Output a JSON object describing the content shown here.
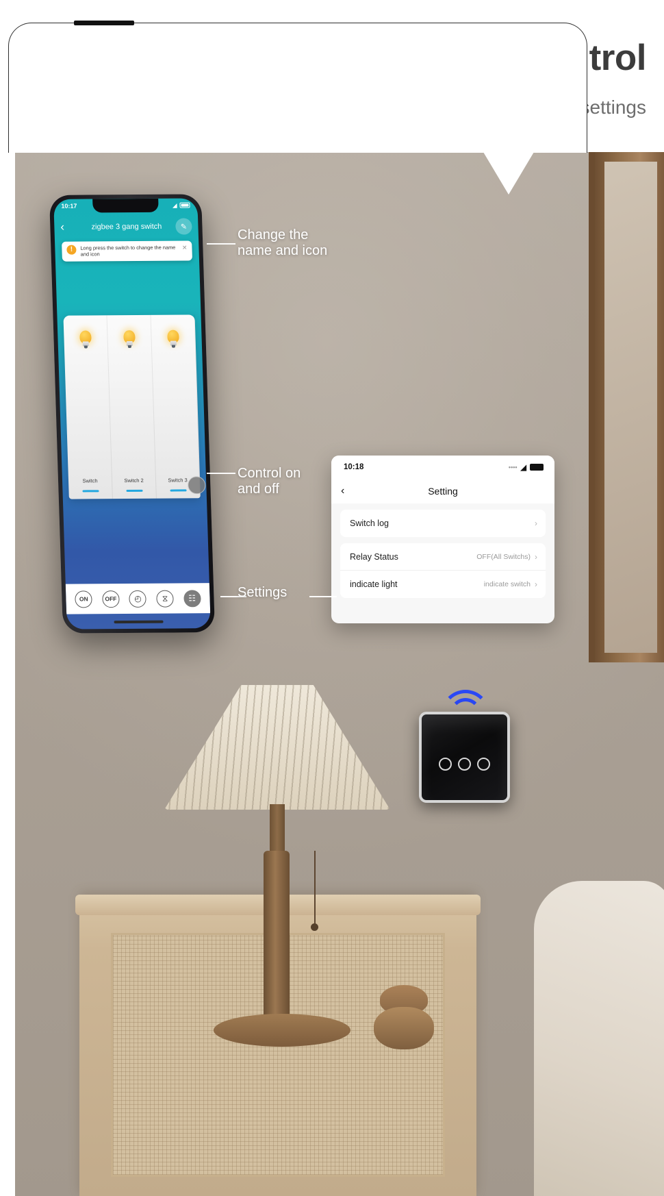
{
  "header": {
    "title": "APP Control",
    "subtitle": "In Tuya App / Smart Life, you can change the settings"
  },
  "phone": {
    "status": {
      "time": "10:17",
      "location_icon": "location-arrow-icon",
      "wifi_icon": "wifi-icon",
      "battery_icon": "battery-icon"
    },
    "nav": {
      "back_icon": "chevron-left-icon",
      "title": "zigbee 3 gang switch",
      "edit_icon": "pencil-icon"
    },
    "toast": {
      "badge": "!",
      "message": "Long press the switch to change the name and icon",
      "close_icon": "close-icon"
    },
    "switches": [
      {
        "label": "Switch",
        "icon": "light-bulb-icon"
      },
      {
        "label": "Switch 2",
        "icon": "light-bulb-icon"
      },
      {
        "label": "Switch 3",
        "icon": "light-bulb-icon"
      }
    ],
    "toolbar": [
      {
        "label": "ON",
        "name": "on-button"
      },
      {
        "label": "OFF",
        "name": "off-button"
      },
      {
        "label": "◴",
        "name": "timer-button"
      },
      {
        "label": "⧖",
        "name": "countdown-button"
      },
      {
        "label": "☷",
        "name": "more-button"
      }
    ]
  },
  "setting": {
    "status": {
      "time": "10:18",
      "location_icon": "location-arrow-icon",
      "signal_icon": "signal-dots-icon",
      "wifi_icon": "wifi-icon",
      "battery_icon": "battery-icon"
    },
    "nav": {
      "back_icon": "chevron-left-icon",
      "title": "Setting"
    },
    "rows": [
      {
        "label": "Switch log",
        "value": "",
        "chevron": "›"
      },
      {
        "label": "Relay Status",
        "value": "OFF(All Switchs)",
        "chevron": "›"
      },
      {
        "label": "indicate light",
        "value": "indicate switch",
        "chevron": "›"
      }
    ]
  },
  "callouts": [
    {
      "text_line1": "Change the",
      "text_line2": "name and icon"
    },
    {
      "text_line1": "Control on",
      "text_line2": "and off"
    },
    {
      "text_line1": "Settings",
      "text_line2": ""
    }
  ],
  "device": {
    "name": "wall-touch-switch",
    "gangs": 3,
    "wifi_icon": "wifi-signal-icon"
  },
  "colors": {
    "accent_teal": "#19b4ba",
    "accent_blue": "#3258a8",
    "wifi_blue": "#2a48f5",
    "bulb_amber": "#f0a81e",
    "switch_bar": "#23a8e0",
    "header_text": "#3c3c3c",
    "header_sub": "#6d6d6d"
  }
}
